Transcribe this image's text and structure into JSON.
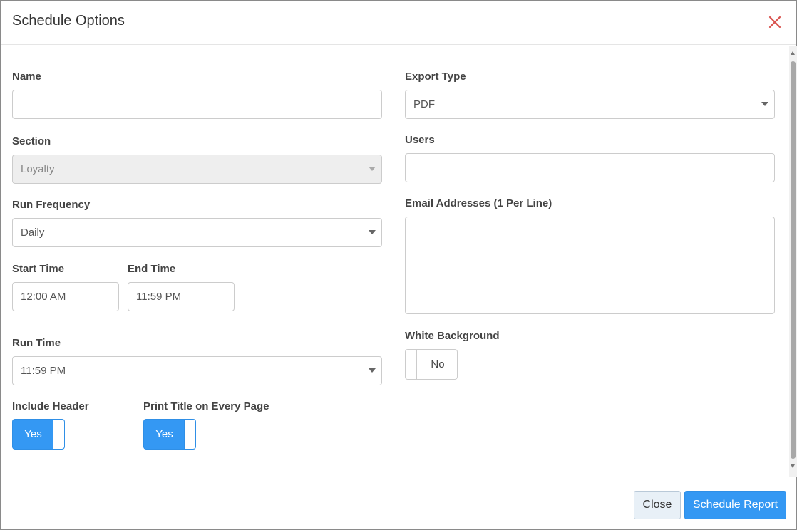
{
  "dialog": {
    "title": "Schedule Options"
  },
  "form": {
    "name": {
      "label": "Name",
      "value": ""
    },
    "section": {
      "label": "Section",
      "value": "Loyalty"
    },
    "run_frequency": {
      "label": "Run Frequency",
      "value": "Daily"
    },
    "start_time": {
      "label": "Start Time",
      "value": "12:00 AM"
    },
    "end_time": {
      "label": "End Time",
      "value": "11:59 PM"
    },
    "run_time": {
      "label": "Run Time",
      "value": "11:59 PM"
    },
    "include_header": {
      "label": "Include Header",
      "state": "Yes"
    },
    "print_title": {
      "label": "Print Title on Every Page",
      "state": "Yes"
    },
    "export_type": {
      "label": "Export Type",
      "value": "PDF"
    },
    "users": {
      "label": "Users",
      "value": ""
    },
    "email_addresses": {
      "label": "Email Addresses (1 Per Line)",
      "value": ""
    },
    "white_background": {
      "label": "White Background",
      "state": "No"
    }
  },
  "footer": {
    "close_label": "Close",
    "schedule_label": "Schedule Report"
  },
  "colors": {
    "accent": "#3498f3",
    "close_icon": "#d9534f"
  },
  "icons": {
    "close": "close-icon",
    "dropdown": "chevron-down-icon"
  }
}
